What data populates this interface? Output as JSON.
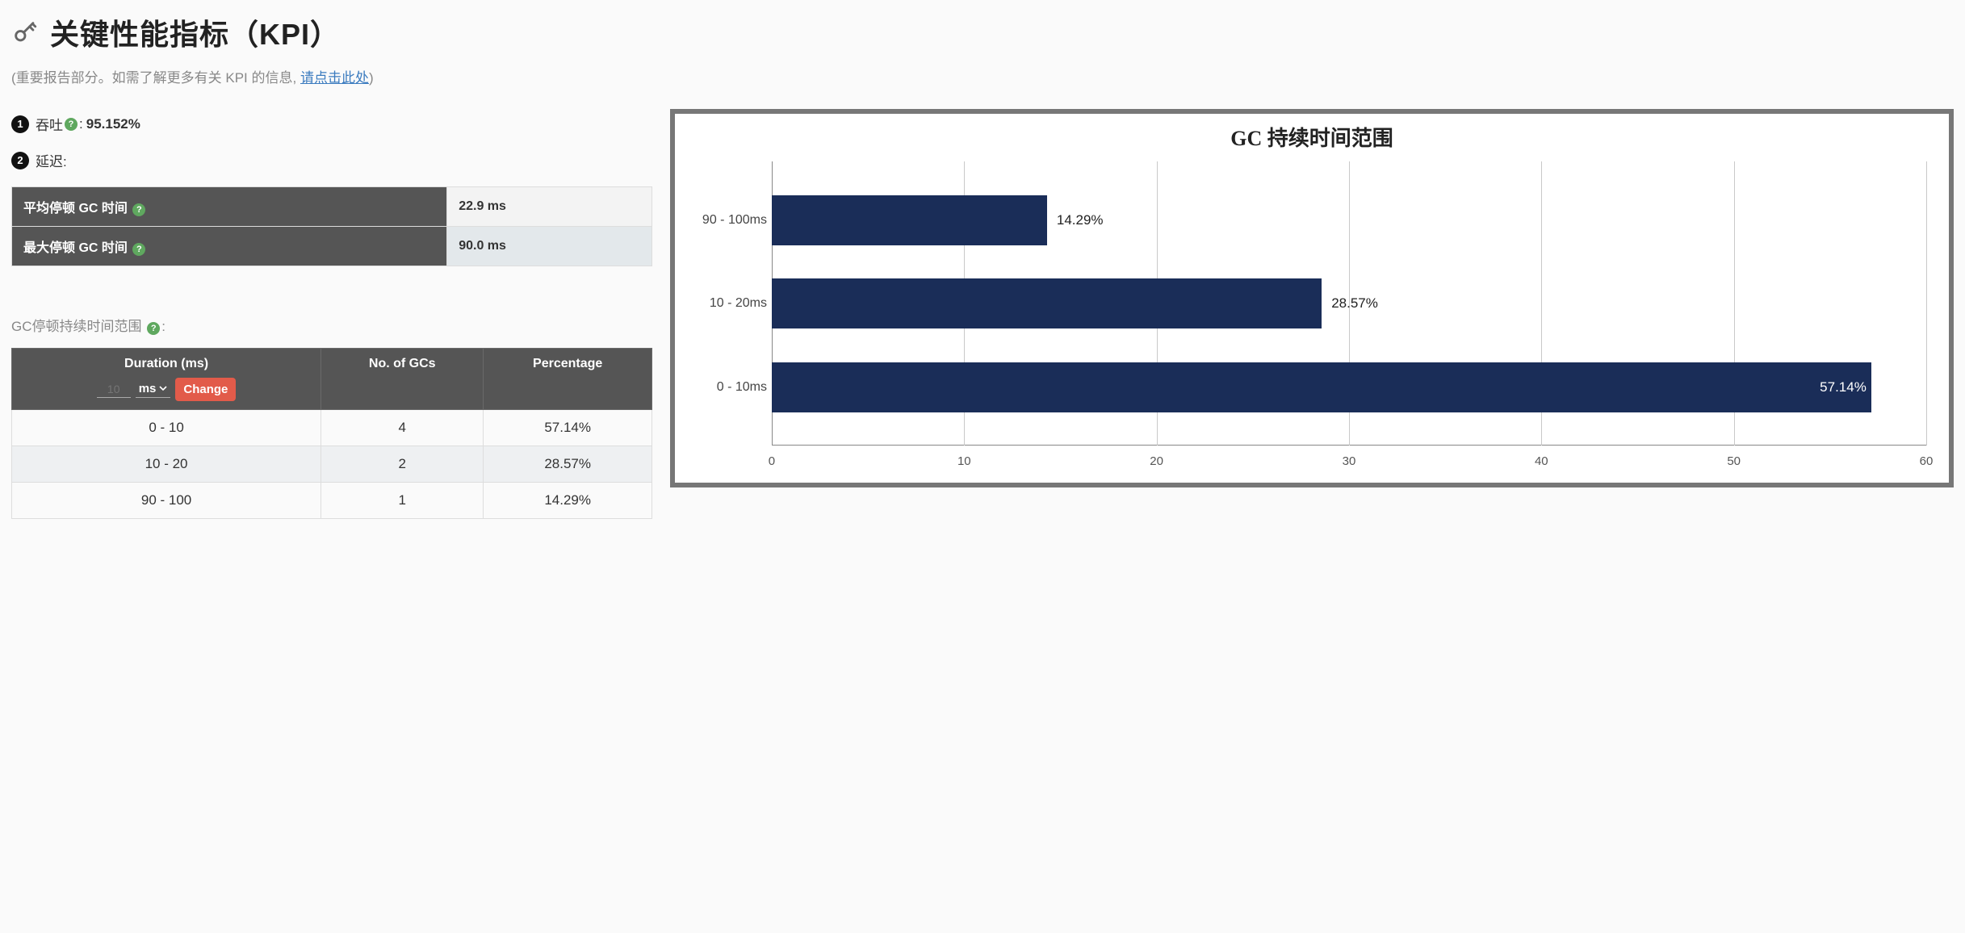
{
  "header": {
    "title": "关键性能指标（KPI）",
    "subtitle_prefix": "(重要报告部分。如需了解更多有关 KPI 的信息, ",
    "subtitle_link": "请点击此处",
    "subtitle_suffix": ")"
  },
  "kpi": {
    "throughput_badge": "1",
    "throughput_label": "吞吐",
    "throughput_sep": " : ",
    "throughput_value": "95.152%",
    "latency_badge": "2",
    "latency_label": "延迟:"
  },
  "latency_table": {
    "rows": [
      {
        "label": "平均停顿 GC 时间",
        "value": "22.9 ms"
      },
      {
        "label": "最大停顿 GC 时间",
        "value": "90.0 ms"
      }
    ]
  },
  "range_section": {
    "heading": "GC停顿持续时间范围",
    "colon": ":"
  },
  "range_table": {
    "headers": {
      "duration": "Duration (ms)",
      "gcs": "No. of GCs",
      "pct": "Percentage"
    },
    "controls": {
      "input_placeholder": "10",
      "unit": "ms",
      "change": "Change"
    },
    "rows": [
      {
        "duration": "0 - 10",
        "gcs": "4",
        "pct": "57.14%"
      },
      {
        "duration": "10 - 20",
        "gcs": "2",
        "pct": "28.57%"
      },
      {
        "duration": "90 - 100",
        "gcs": "1",
        "pct": "14.29%"
      }
    ]
  },
  "chart_data": {
    "type": "bar",
    "orientation": "horizontal",
    "title": "GC 持续时间范围",
    "categories": [
      "90 - 100ms",
      "10 - 20ms",
      "0 - 10ms"
    ],
    "values": [
      14.29,
      28.57,
      57.14
    ],
    "value_labels": [
      "14.29%",
      "28.57%",
      "57.14%"
    ],
    "xlim": [
      0,
      60
    ],
    "x_ticks": [
      0,
      10,
      20,
      30,
      40,
      50,
      60
    ],
    "bar_color": "#1a2d58"
  }
}
